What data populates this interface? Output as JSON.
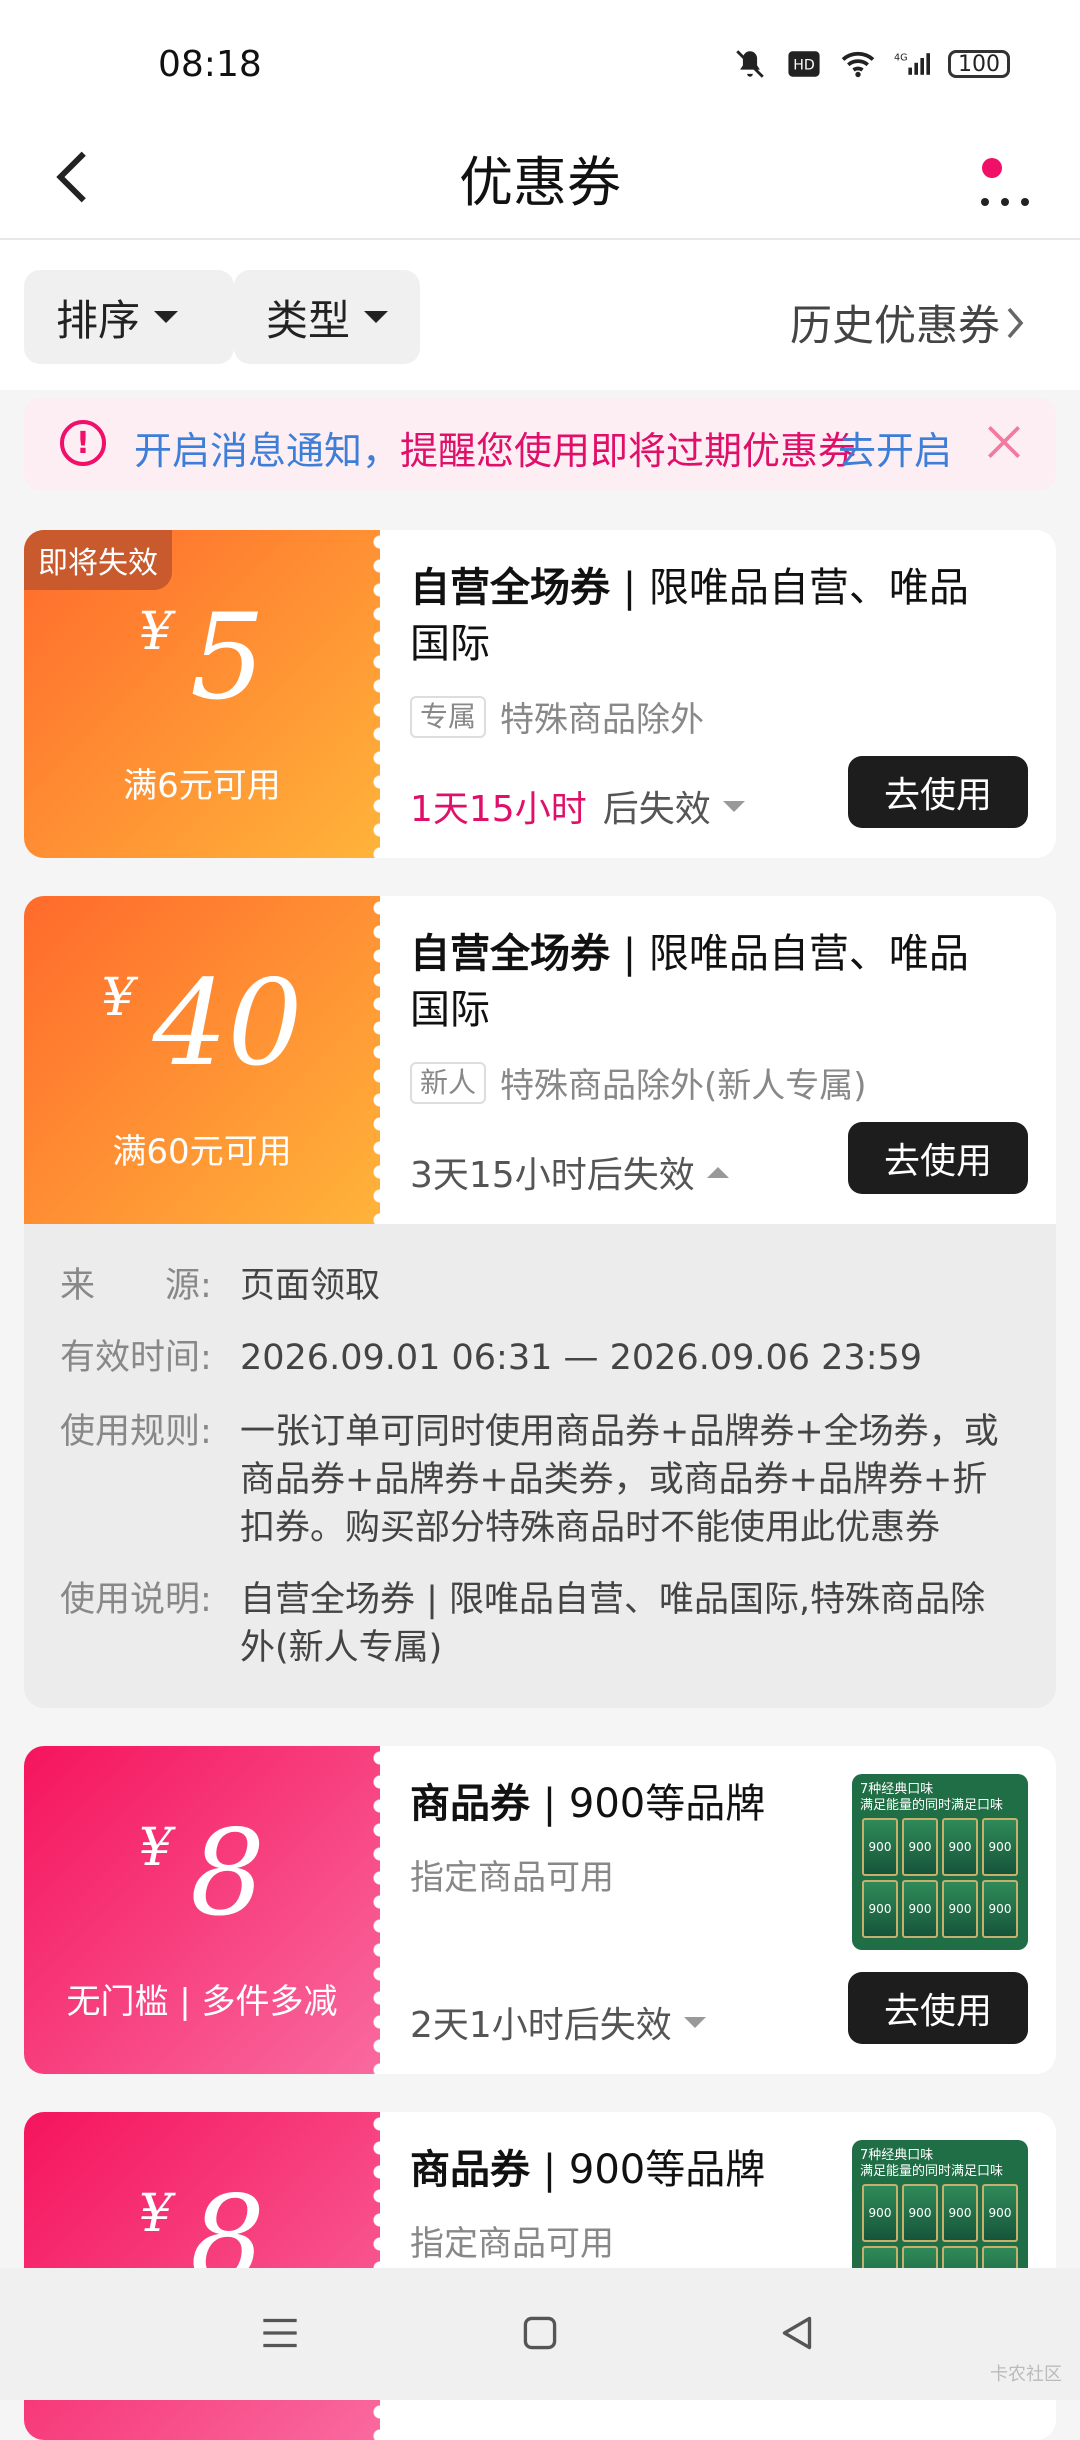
{
  "status": {
    "time": "08:18",
    "battery": "100",
    "icons": [
      "mute-bell-icon",
      "hd-icon",
      "wifi-icon",
      "4g-signal-icon",
      "battery-icon"
    ]
  },
  "header": {
    "title": "优惠券",
    "back": "back-arrow-icon",
    "more": "more-dots-icon"
  },
  "filters": {
    "sort": "排序",
    "type": "类型",
    "history": "历史优惠券"
  },
  "notice": {
    "text1": "开启消息通知，",
    "text2": "提醒您使用即将过期优惠券",
    "action": "去开启"
  },
  "coupons": [
    {
      "badge": "即将失效",
      "currency": "¥",
      "amount": "5",
      "condition": "满6元可用",
      "title_bold": "自营全场券",
      "title_rest": " | 限唯品自营、唯品国际",
      "tag": "专属",
      "desc": "特殊商品除外",
      "expiry_hl": "1天15小时",
      "expiry": "后失效",
      "button": "去使用",
      "style": "orange"
    },
    {
      "currency": "¥",
      "amount": "40",
      "condition": "满60元可用",
      "title_bold": "自营全场券",
      "title_rest": " | 限唯品自营、唯品国际",
      "tag": "新人",
      "desc": "特殊商品除外(新人专属)",
      "expiry": "3天15小时后失效",
      "button": "去使用",
      "style": "orange"
    },
    {
      "currency": "¥",
      "amount": "8",
      "condition": "无门槛 | 多件多减",
      "title_bold": "商品券",
      "title_rest": " | 900等品牌",
      "desc": "指定商品可用",
      "expiry": "2天1小时后失效",
      "button": "去使用",
      "style": "pink",
      "thumb": {
        "line1": "7种经典口味",
        "line2": "满足能量的同时满足口味",
        "pack": "900"
      }
    },
    {
      "currency": "¥",
      "amount": "8",
      "title_bold": "商品券",
      "title_rest": " | 900等品牌",
      "desc": "指定商品可用",
      "style": "pink",
      "thumb": {
        "line1": "7种经典口味",
        "line2": "满足能量的同时满足口味",
        "pack": "900"
      }
    }
  ],
  "detail": {
    "source_label": "来　　源:",
    "source": "页面领取",
    "valid_label": "有效时间:",
    "valid": "2026.09.01 06:31 — 2026.09.06 23:59",
    "rules_label": "使用规则:",
    "rules": "一张订单可同时使用商品券+品牌券+全场券，或商品券+品牌券+品类券，或商品券+品牌券+折扣券。购买部分特殊商品时不能使用此优惠券",
    "desc_label": "使用说明:",
    "desc": "自营全场券 | 限唯品自营、唯品国际,特殊商品除外(新人专属)"
  },
  "watermark": "卡农社区",
  "colors": {
    "accent": "#f0106a",
    "link": "#3d7ed8",
    "button": "#1d1d1d",
    "orange_start": "#ff6a2c",
    "orange_end": "#ffb43a",
    "pink_start": "#f5145e",
    "pink_end": "#f96a9e"
  }
}
